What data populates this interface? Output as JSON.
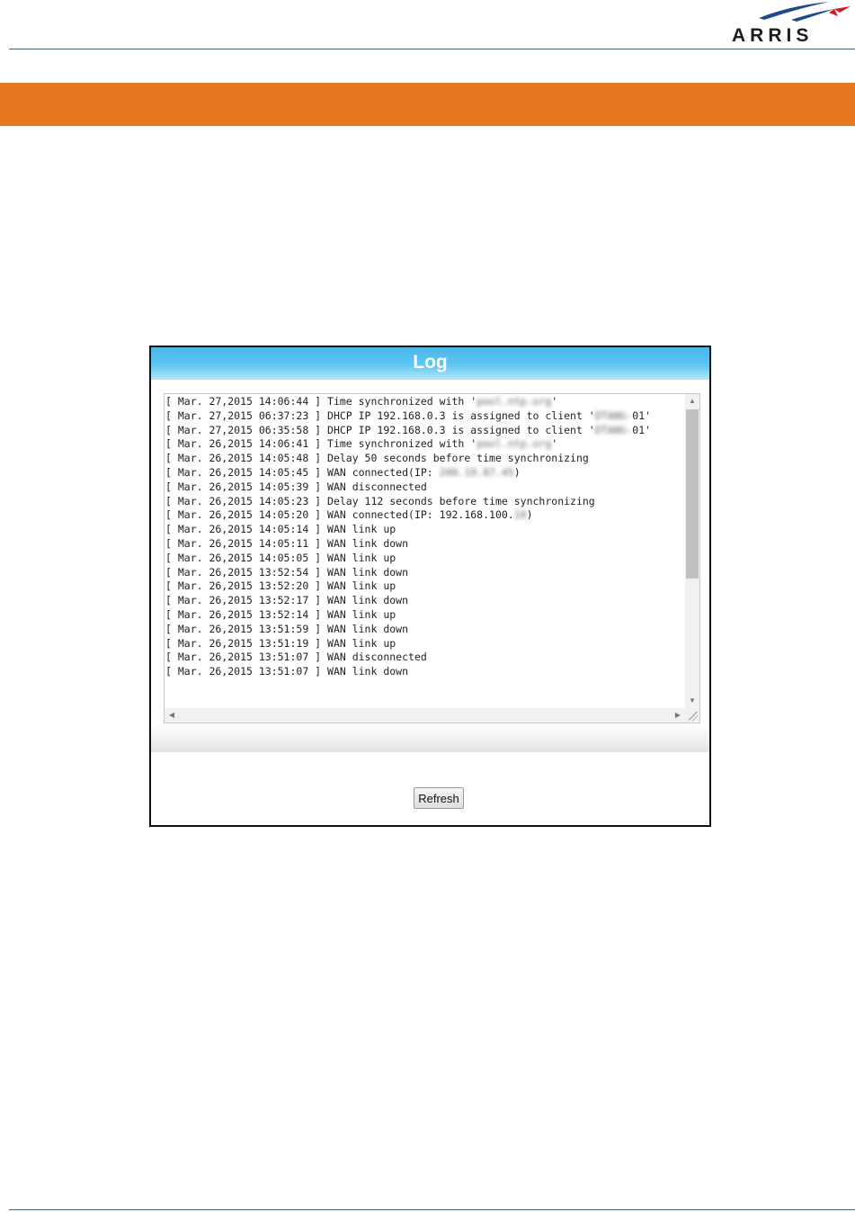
{
  "brand": {
    "name": "ARRIS",
    "swoosh_colors": [
      "#1e4a8a",
      "#d71920"
    ]
  },
  "colors": {
    "band": "#e87722",
    "header": "#5fc6f2",
    "rule": "#4f6279"
  },
  "window": {
    "title": "Log"
  },
  "log": {
    "lines": [
      {
        "time": "[ Mar. 27,2015 14:06:44 ] ",
        "msg": "Time synchronized with '",
        "blur": "pool.ntp.org",
        "tail": "'"
      },
      {
        "time": "[ Mar. 27,2015 06:37:23 ] ",
        "msg": "DHCP IP 192.168.0.3 is assigned to client '",
        "blur": "DTANG-",
        "tail": "01'"
      },
      {
        "time": "[ Mar. 27,2015 06:35:58 ] ",
        "msg": "DHCP IP 192.168.0.3 is assigned to client '",
        "blur": "DTANG-",
        "tail": "01'"
      },
      {
        "time": "[ Mar. 26,2015 14:06:41 ] ",
        "msg": "Time synchronized with '",
        "blur": "pool.ntp.org",
        "tail": "'"
      },
      {
        "time": "[ Mar. 26,2015 14:05:48 ] ",
        "msg": "Delay 50 seconds before time synchronizing",
        "blur": "",
        "tail": ""
      },
      {
        "time": "[ Mar. 26,2015 14:05:45 ] ",
        "msg": "WAN connected(IP: ",
        "blur": "200.19.87.45",
        "tail": ")"
      },
      {
        "time": "[ Mar. 26,2015 14:05:39 ] ",
        "msg": "WAN disconnected",
        "blur": "",
        "tail": ""
      },
      {
        "time": "[ Mar. 26,2015 14:05:23 ] ",
        "msg": "Delay 112 seconds before time synchronizing",
        "blur": "",
        "tail": ""
      },
      {
        "time": "[ Mar. 26,2015 14:05:20 ] ",
        "msg": "WAN connected(IP: 192.168.100.",
        "blur": "10",
        "tail": ")"
      },
      {
        "time": "[ Mar. 26,2015 14:05:14 ] ",
        "msg": "WAN link up",
        "blur": "",
        "tail": ""
      },
      {
        "time": "[ Mar. 26,2015 14:05:11 ] ",
        "msg": "WAN link down",
        "blur": "",
        "tail": ""
      },
      {
        "time": "[ Mar. 26,2015 14:05:05 ] ",
        "msg": "WAN link up",
        "blur": "",
        "tail": ""
      },
      {
        "time": "[ Mar. 26,2015 13:52:54 ] ",
        "msg": "WAN link down",
        "blur": "",
        "tail": ""
      },
      {
        "time": "[ Mar. 26,2015 13:52:20 ] ",
        "msg": "WAN link up",
        "blur": "",
        "tail": ""
      },
      {
        "time": "[ Mar. 26,2015 13:52:17 ] ",
        "msg": "WAN link down",
        "blur": "",
        "tail": ""
      },
      {
        "time": "[ Mar. 26,2015 13:52:14 ] ",
        "msg": "WAN link up",
        "blur": "",
        "tail": ""
      },
      {
        "time": "[ Mar. 26,2015 13:51:59 ] ",
        "msg": "WAN link down",
        "blur": "",
        "tail": ""
      },
      {
        "time": "[ Mar. 26,2015 13:51:19 ] ",
        "msg": "WAN link up",
        "blur": "",
        "tail": ""
      },
      {
        "time": "[ Mar. 26,2015 13:51:07 ] ",
        "msg": "WAN disconnected",
        "blur": "",
        "tail": ""
      },
      {
        "time": "[ Mar. 26,2015 13:51:07 ] ",
        "msg": "WAN link down",
        "blur": "",
        "tail": ""
      }
    ]
  },
  "buttons": {
    "refresh": "Refresh"
  }
}
